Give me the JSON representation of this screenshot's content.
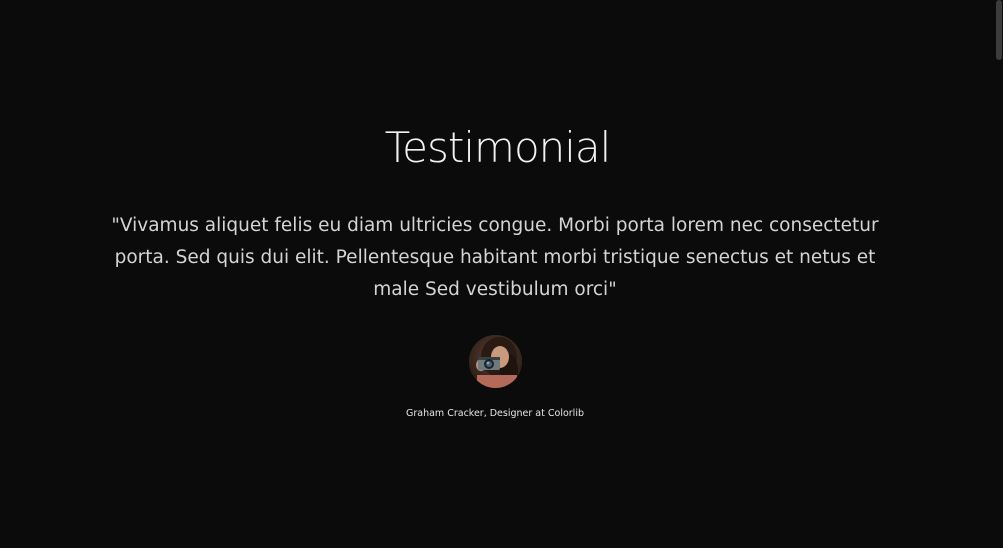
{
  "testimonial": {
    "heading": "Testimonial",
    "quote": "\"Vivamus aliquet felis eu diam ultricies congue. Morbi porta lorem nec consectetur porta. Sed quis dui elit. Pellentesque habitant morbi tristique senectus et netus et male Sed vestibulum orci\"",
    "author": "Graham Cracker, Designer at Colorlib"
  },
  "colors": {
    "background": "#0b0b0b",
    "text": "#d4d4d4",
    "heading": "#f2f2f2"
  }
}
